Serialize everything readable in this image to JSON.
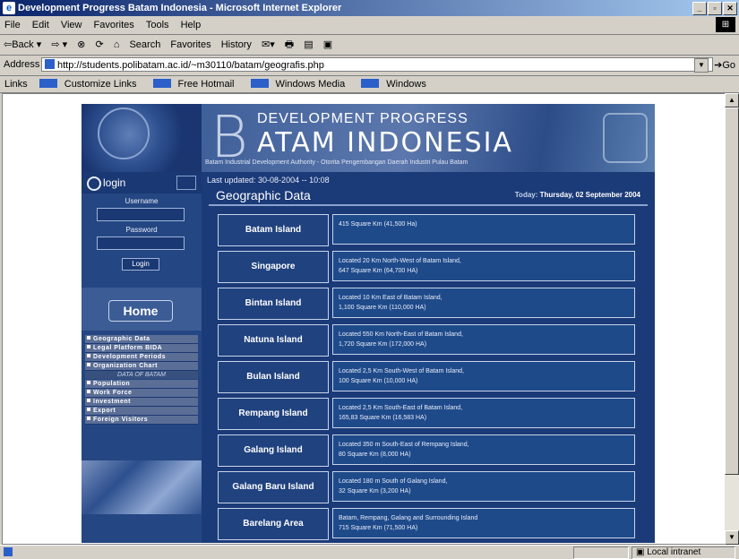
{
  "window": {
    "title": "Development Progress Batam Indonesia - Microsoft Internet Explorer",
    "menu": [
      "File",
      "Edit",
      "View",
      "Favorites",
      "Tools",
      "Help"
    ],
    "toolbar": [
      "⇦Back ▾",
      "⇨ ▾",
      "⊗",
      "⟳",
      "⌂",
      "Search",
      "Favorites",
      "History",
      "✉▾",
      "🖶",
      "▤",
      "▣"
    ],
    "address_label": "Address",
    "address_url": "http://students.polibatam.ac.id/~m30110/batam/geografis.php",
    "go_label": "Go",
    "links_label": "Links",
    "links": [
      "Customize Links",
      "Free Hotmail",
      "Windows Media",
      "Windows"
    ],
    "status_zone": "Local intranet"
  },
  "site": {
    "banner_line1": "DEVELOPMENT PROGRESS",
    "banner_line2": "ATAM INDONESIA",
    "banner_b": "B",
    "tagline": "Batam Industrial Development Authority - Otorita Pengembangan Daerah Industri Pulau Batam",
    "login_label": "login",
    "username_label": "Username",
    "password_label": "Password",
    "login_button": "Login",
    "home_label": "Home",
    "nav": [
      "Geographic Data",
      "Legal Platform BIDA",
      "Development Periods",
      "Organization Chart"
    ],
    "nav_section": "DATA OF BATAM",
    "nav2": [
      "Population",
      "Work Force",
      "Investment",
      "Export",
      "Foreign Visitors"
    ],
    "last_updated": "Last updated: 30-08-2004 -- 10:08",
    "page_title": "Geographic Data",
    "today_label": "Today:",
    "today_value": "Thursday, 02 September 2004",
    "rows": [
      {
        "name": "Batam Island",
        "line1": "415 Square Km (41,500 Ha)",
        "line2": ""
      },
      {
        "name": "Singapore",
        "line1": "Located 20 Km North-West of Batam Island,",
        "line2": "647 Square Km (64,700 HA)"
      },
      {
        "name": "Bintan Island",
        "line1": "Located 10 Km East of Batam Island,",
        "line2": "1,100 Square Km (110,000 HA)"
      },
      {
        "name": "Natuna Island",
        "line1": "Located 550 Km North-East of Batam Island,",
        "line2": "1,720 Square Km (172,000 HA)"
      },
      {
        "name": "Bulan Island",
        "line1": "Located 2,5 Km South-West of Batam Island,",
        "line2": "100 Square Km (10,000 HA)"
      },
      {
        "name": "Rempang Island",
        "line1": "Located 2,5 Km South-East of Batam Island,",
        "line2": "165,83 Square Km (16,583 HA)"
      },
      {
        "name": "Galang Island",
        "line1": "Located 350 m South-East of Rempang Island,",
        "line2": "80 Square Km (8,000 HA)"
      },
      {
        "name": "Galang Baru Island",
        "line1": "Located 180 m South of Galang Island,",
        "line2": "32 Square Km (3,200 HA)"
      },
      {
        "name": "Barelang Area",
        "line1": "Batam, Rempang, Galang and Surrounding Island",
        "line2": "715 Square Km (71,500 HA)"
      }
    ]
  }
}
